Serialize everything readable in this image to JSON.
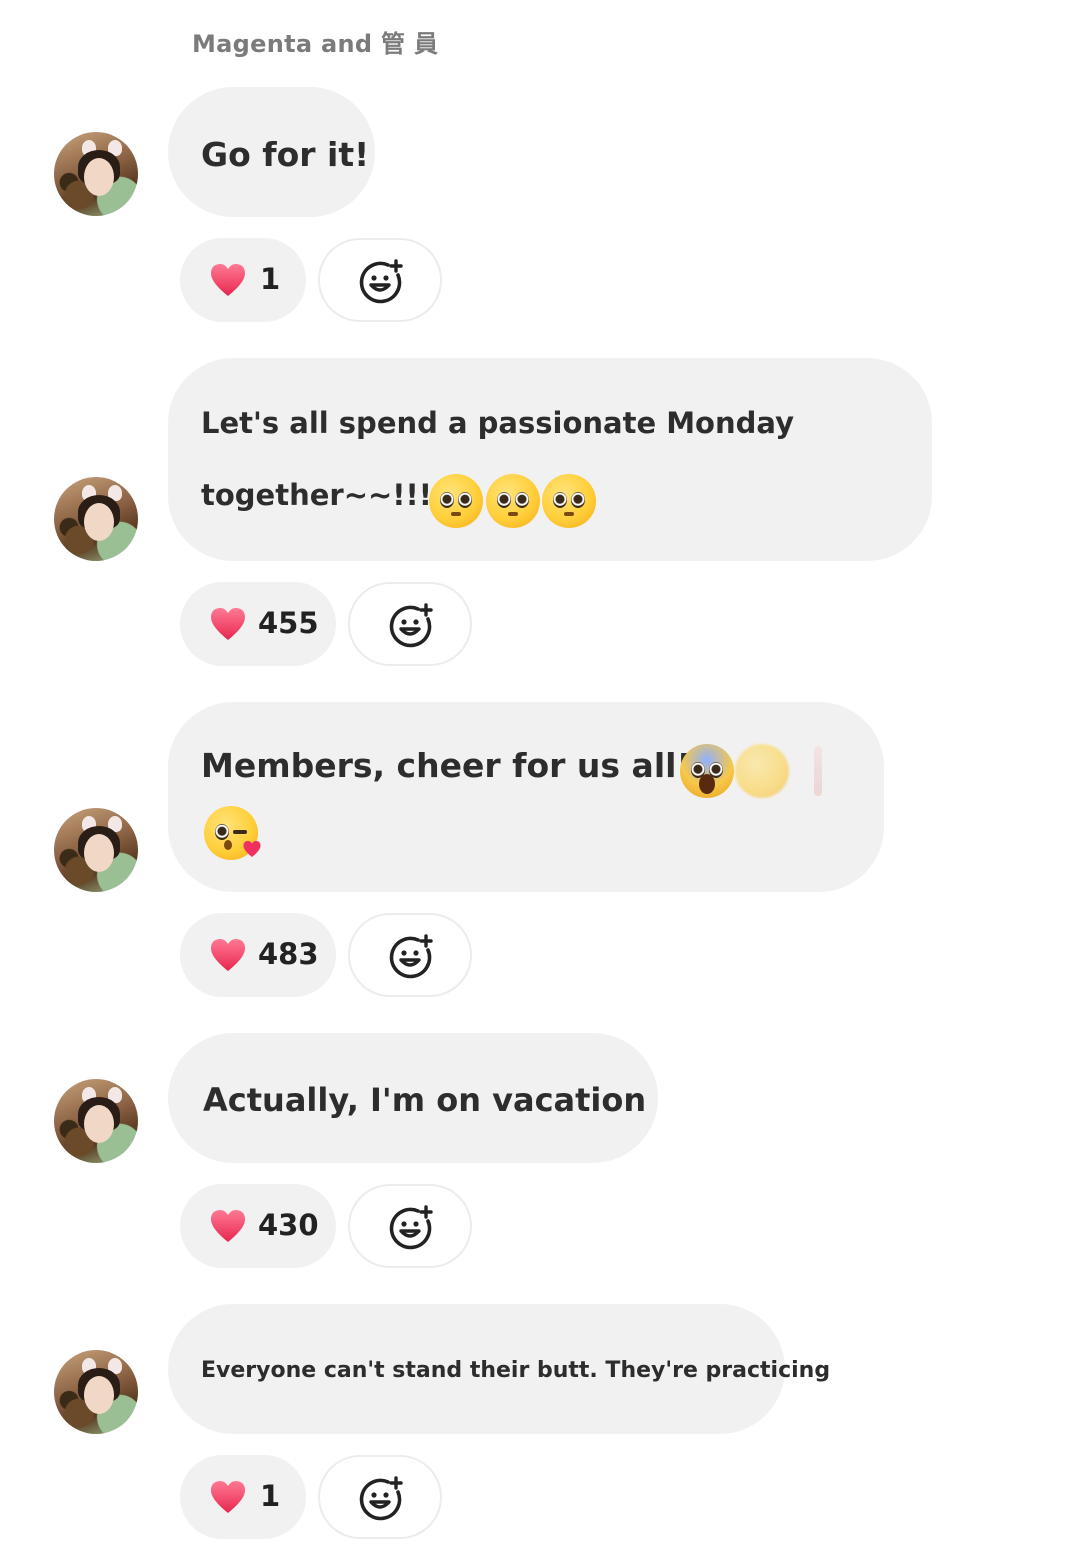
{
  "header": {
    "sender": "Magenta and 管 員"
  },
  "messages": [
    {
      "text_lines": [
        "Go for it!"
      ],
      "likes": "1"
    },
    {
      "text_lines": [
        "Let's all spend a passionate Monday",
        "together~~!!!"
      ],
      "emojis": [
        "pleading-face-emoji",
        "pleading-face-emoji",
        "pleading-face-emoji"
      ],
      "likes": "455"
    },
    {
      "text_lines": [
        "Members, cheer for us all!"
      ],
      "emojis": [
        "screaming-face-emoji",
        "faded-emoji",
        "exclamation-emoji",
        "kissing-face-emoji"
      ],
      "likes": "483"
    },
    {
      "text_lines": [
        "Actually, I'm on vacation"
      ],
      "likes": "430"
    },
    {
      "text_lines": [
        "Everyone can't stand their butt. They're practicing"
      ],
      "likes": "1"
    }
  ],
  "icons": {
    "heart": "heart-icon",
    "add_reaction": "add-reaction-icon"
  },
  "colors": {
    "bubble": "#f1f1f1",
    "heart": "#f2466e",
    "sender_text": "#7b7b7b"
  }
}
